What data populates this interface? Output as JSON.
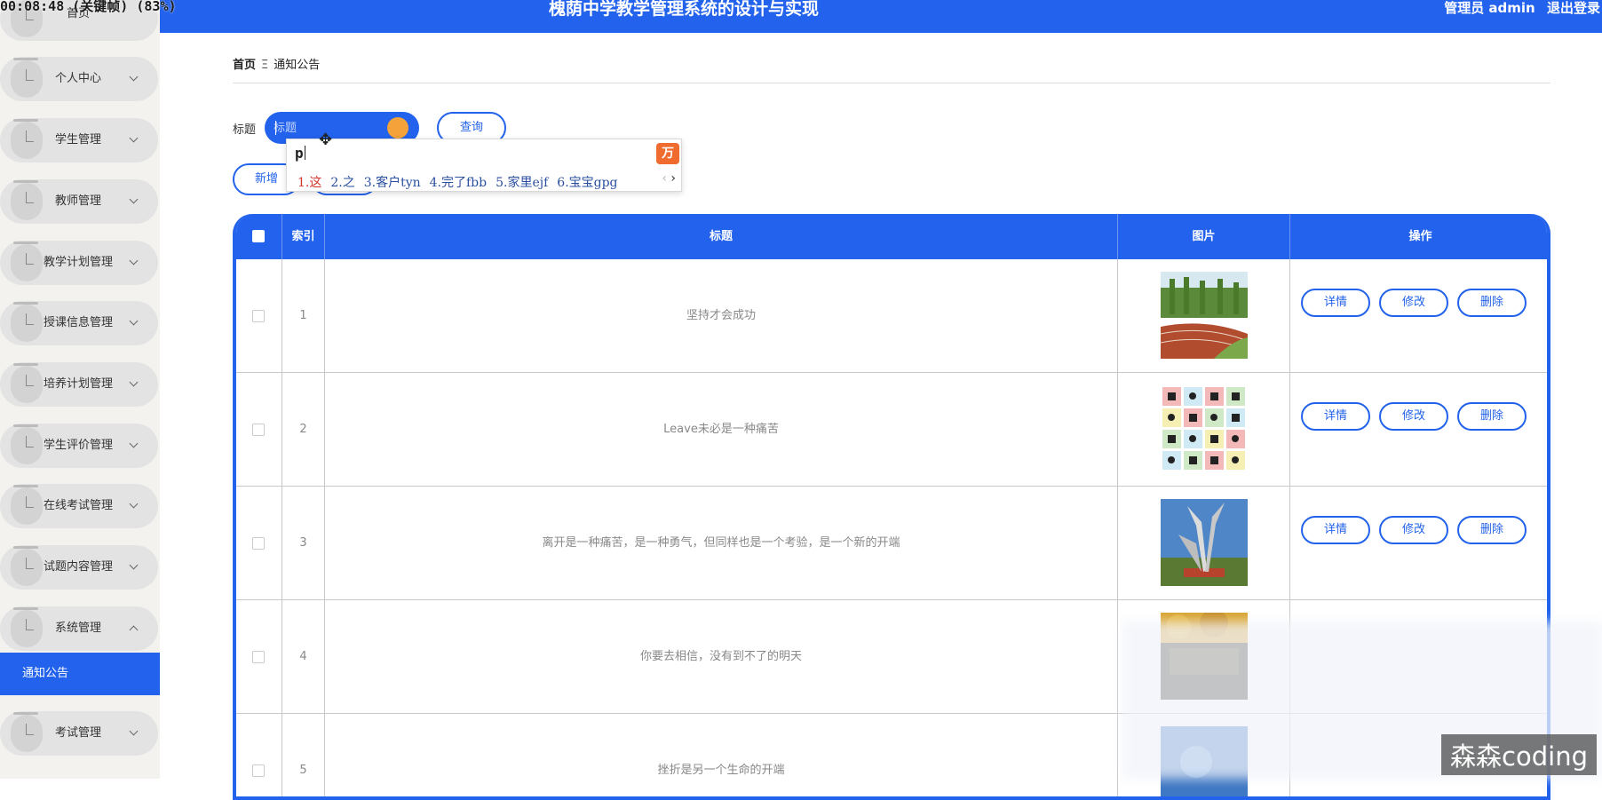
{
  "recording_overlay": "00:08:48 (关键帧) (83%)",
  "header": {
    "title": "槐荫中学教学管理系统的设计与实现",
    "user_label": "管理员 admin",
    "logout_label": "退出登录",
    "bg_color": "#2262ec"
  },
  "sidebar": {
    "items": [
      {
        "label": "首页",
        "chevron": false
      },
      {
        "label": "个人中心",
        "chevron": "down"
      },
      {
        "label": "学生管理",
        "chevron": "down"
      },
      {
        "label": "教师管理",
        "chevron": "down"
      },
      {
        "label": "教学计划管理",
        "chevron": "down"
      },
      {
        "label": "授课信息管理",
        "chevron": "down"
      },
      {
        "label": "培养计划管理",
        "chevron": "down"
      },
      {
        "label": "学生评价管理",
        "chevron": "down"
      },
      {
        "label": "在线考试管理",
        "chevron": "down"
      },
      {
        "label": "试题内容管理",
        "chevron": "down"
      },
      {
        "label": "系统管理",
        "chevron": "up"
      },
      {
        "label": "考试管理",
        "chevron": "down"
      }
    ],
    "active_submenu": "通知公告"
  },
  "breadcrumb": {
    "home": "首页",
    "separator": "Ξ",
    "current": "通知公告"
  },
  "search": {
    "label": "标题",
    "placeholder": "标题",
    "value": "",
    "query_button": "查询"
  },
  "actions": {
    "add_button": "新增",
    "delete_button": "删除"
  },
  "ime": {
    "typed": "p",
    "candidates": [
      "1.这",
      "2.之",
      "3.客户tyn",
      "4.完了fbb",
      "5.家里ejf",
      "6.宝宝gpg"
    ],
    "logo_glyph": "万",
    "prev": "‹",
    "next": "›"
  },
  "table": {
    "columns": [
      "索引",
      "标题",
      "图片",
      "操作"
    ],
    "op_labels": {
      "detail": "详情",
      "edit": "修改",
      "delete": "删除"
    },
    "rows": [
      {
        "index": "1",
        "title": "坚持才会成功",
        "image": "track-photo"
      },
      {
        "index": "2",
        "title": "Leave未必是一种痛苦",
        "image": "icon-grid"
      },
      {
        "index": "3",
        "title": "离开是一种痛苦，是一种勇气，但同样也是一个考验，是一个新的开端",
        "image": "sculpture-photo"
      },
      {
        "index": "4",
        "title": "你要去相信，没有到不了的明天",
        "image": "autumn-photo"
      },
      {
        "index": "5",
        "title": "挫折是另一个生命的开端",
        "image": "sky-photo"
      }
    ]
  },
  "watermark": "森森coding"
}
